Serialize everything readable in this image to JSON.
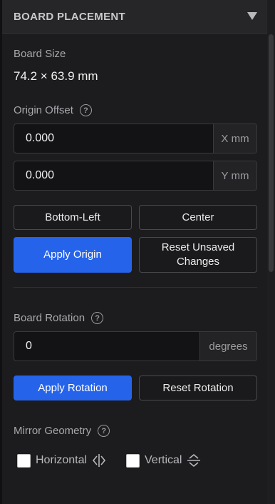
{
  "header": {
    "title": "BOARD PLACEMENT",
    "collapse_icon": "triangle-down-icon"
  },
  "board_size": {
    "label": "Board Size",
    "value": "74.2 × 63.9 mm"
  },
  "origin_offset": {
    "label": "Origin Offset",
    "x": {
      "value": "0.000",
      "unit": "X mm"
    },
    "y": {
      "value": "0.000",
      "unit": "Y mm"
    },
    "buttons": {
      "bottom_left": "Bottom-Left",
      "center": "Center",
      "apply": "Apply Origin",
      "reset": "Reset Unsaved Changes"
    }
  },
  "rotation": {
    "label": "Board Rotation",
    "value": "0",
    "unit": "degrees",
    "apply": "Apply Rotation",
    "reset": "Reset Rotation"
  },
  "mirror": {
    "label": "Mirror Geometry",
    "horizontal": {
      "label": "Horizontal",
      "checked": false,
      "icon": "flip-horizontal-icon"
    },
    "vertical": {
      "label": "Vertical",
      "checked": false,
      "icon": "flip-vertical-icon"
    }
  },
  "colors": {
    "accent": "#2563eb",
    "background": "#1c1c1e",
    "header": "#262628"
  }
}
